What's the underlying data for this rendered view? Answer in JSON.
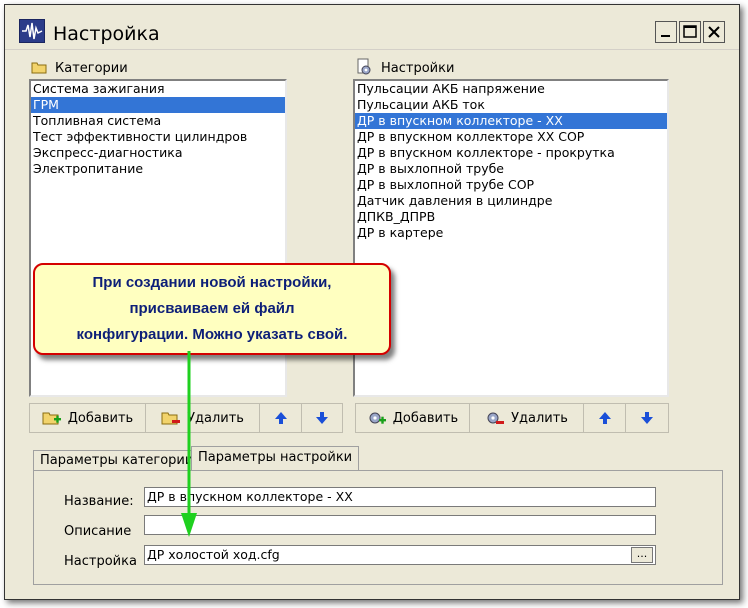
{
  "window": {
    "title": "Настройка",
    "buttons": {
      "minimize": "_",
      "maximize": "□",
      "close": "✕"
    }
  },
  "categories_panel": {
    "label": "Категории",
    "items": [
      {
        "label": "Система зажигания",
        "selected": false
      },
      {
        "label": "ГРМ",
        "selected": true
      },
      {
        "label": "Топливная система",
        "selected": false
      },
      {
        "label": "Тест эффективности цилиндров",
        "selected": false
      },
      {
        "label": "Экспресс-диагностика",
        "selected": false
      },
      {
        "label": "Электропитание",
        "selected": false
      }
    ],
    "add_label": "Добавить",
    "delete_label": "Удалить"
  },
  "settings_panel": {
    "label": "Настройки",
    "items": [
      {
        "label": "Пульсации АКБ напряжение",
        "selected": false
      },
      {
        "label": "Пульсации АКБ ток",
        "selected": false
      },
      {
        "label": "ДР в впускном коллекторе - ХХ",
        "selected": true
      },
      {
        "label": "ДР в впускном коллекторе ХХ СОР",
        "selected": false
      },
      {
        "label": "ДР в впускном коллекторе - прокрутка",
        "selected": false
      },
      {
        "label": "ДР в выхлопной трубе",
        "selected": false
      },
      {
        "label": "ДР в выхлопной трубе СОР",
        "selected": false
      },
      {
        "label": "Датчик давления в цилиндре",
        "selected": false
      },
      {
        "label": "ДПКВ_ДПРВ",
        "selected": false
      },
      {
        "label": "ДР в картере",
        "selected": false
      }
    ],
    "add_label": "Добавить",
    "delete_label": "Удалить"
  },
  "tabs": [
    {
      "label": "Параметры категории",
      "active": false
    },
    {
      "label": "Параметры настройки",
      "active": true
    }
  ],
  "form": {
    "name_label": "Название:",
    "name_value": "ДР в впускном коллекторе - ХХ",
    "description_label": "Описание",
    "description_value": "",
    "config_label": "Настройка",
    "config_value": "ДР холостой ход.cfg",
    "browse_label": "..."
  },
  "callout": {
    "text": "При создании новой настройки,\nприсваиваем ей файл\nконфигурации. Можно указать свой."
  },
  "colors": {
    "selection": "#3375d6",
    "callout_border": "#d40000",
    "callout_fill": "#ffffc0",
    "callout_text": "#0d1f78",
    "arrow_up": "#1a4fd8",
    "arrow_green": "#1fd01f"
  }
}
